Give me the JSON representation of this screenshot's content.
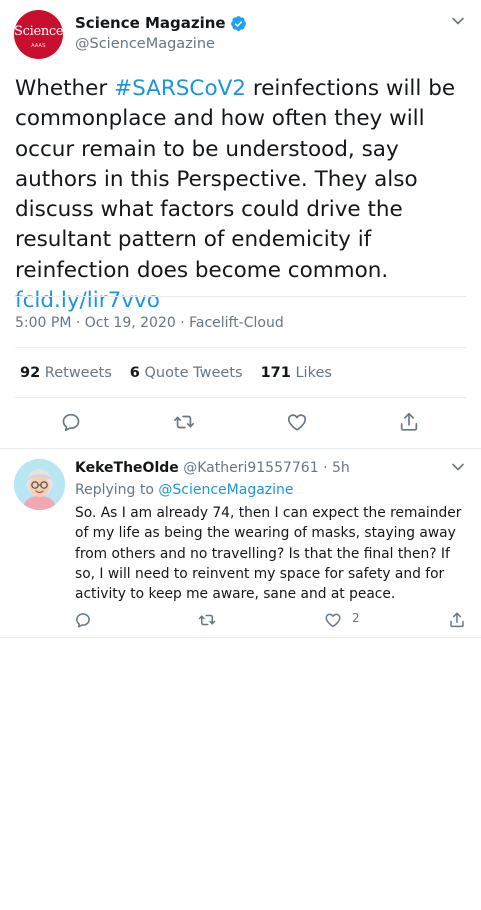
{
  "main_tweet": {
    "avatar_logo": "Science",
    "avatar_logo_sub": "AAAS",
    "author_name": "Science Magazine",
    "author_handle": "@ScienceMagazine",
    "text_before_hashtag": "Whether ",
    "hashtag": "#SARSCoV2",
    "text_after_hashtag": " reinfections will be commonplace and how often they will occur remain to be understood, say authors in this Perspective. They also discuss what factors could drive the resultant pattern of endemicity if reinfection does become common. ",
    "link": "fcld.ly/lir7vvo",
    "timestamp": "5:00 PM · Oct 19, 2020 · Facelift-Cloud",
    "stats": {
      "retweets_count": "92",
      "retweets_label": "Retweets",
      "quotes_count": "6",
      "quotes_label": "Quote Tweets",
      "likes_count": "171",
      "likes_label": "Likes"
    }
  },
  "reply": {
    "author_name": "KekeTheOlde",
    "author_handle": "@Katheri91557761",
    "time": " · 5h",
    "replying_label": "Replying to ",
    "replying_to": "@ScienceMagazine",
    "text": "So. As I am already 74, then I can expect the remainder of my life as being the wearing of masks, staying away from others and no travelling? Is that the final then? If so, I will need to reinvent my space for safety and for activity to keep me aware, sane and at peace.",
    "like_count": "2"
  },
  "colors": {
    "accent": "#1b95e0",
    "text_secondary": "#657786",
    "border": "#e6ecf0",
    "verified": "#1da1f2",
    "brand_red": "#c8102e"
  },
  "icons": [
    "chevron-down-icon",
    "verified-badge-icon",
    "reply-icon",
    "retweet-icon",
    "like-icon",
    "share-icon"
  ]
}
